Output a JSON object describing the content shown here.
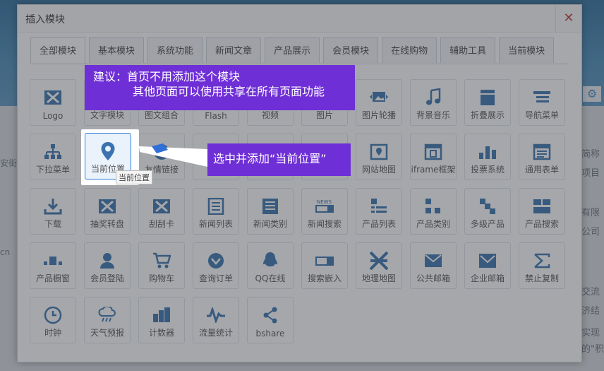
{
  "background": {
    "gear_icon": "⚙",
    "left_fragments": [
      "安街",
      "cn"
    ],
    "right_fragments": [
      "简称",
      "项目",
      "有限",
      "公司",
      "交流",
      "济结",
      "实现",
      "的\"积"
    ]
  },
  "dialog": {
    "title": "插入模块",
    "close_label": "✕",
    "tabs": [
      "全部模块",
      "基本模块",
      "系统功能",
      "新闻文章",
      "产品展示",
      "会员模块",
      "在线购物",
      "辅助工具",
      "当前模块"
    ],
    "active_tab": "全部模块",
    "modules": [
      {
        "label": "Logo",
        "icon": "x-box-icon"
      },
      {
        "label": "文字模块",
        "icon": "text-icon"
      },
      {
        "label": "图文组合",
        "icon": "image-text-icon"
      },
      {
        "label": "Flash",
        "icon": "flash-icon"
      },
      {
        "label": "视频",
        "icon": "video-icon"
      },
      {
        "label": "图片",
        "icon": "image-icon"
      },
      {
        "label": "图片轮播",
        "icon": "carousel-icon"
      },
      {
        "label": "背景音乐",
        "icon": "music-note-icon"
      },
      {
        "label": "折叠展示",
        "icon": "folder-icon"
      },
      {
        "label": "导航菜单",
        "icon": "nav-menu-icon"
      },
      {
        "label": "下拉菜单",
        "icon": "dropdown-menu-icon"
      },
      {
        "label": "当前位置",
        "icon": "location-pin-icon"
      },
      {
        "label": "友情链接",
        "icon": "globe-icon"
      },
      {
        "label": "友",
        "icon": "friend-icon"
      },
      {
        "label": "",
        "icon": "hidden-icon"
      },
      {
        "label": "",
        "icon": "hidden-icon"
      },
      {
        "label": "网站地图",
        "icon": "site-map-icon"
      },
      {
        "label": "iframe框架",
        "icon": "iframe-icon"
      },
      {
        "label": "投票系统",
        "icon": "vote-icon"
      },
      {
        "label": "通用表单",
        "icon": "form-icon"
      },
      {
        "label": "下载",
        "icon": "download-icon"
      },
      {
        "label": "抽奖转盘",
        "icon": "x-box-icon"
      },
      {
        "label": "刮刮卡",
        "icon": "x-box-icon"
      },
      {
        "label": "新闻列表",
        "icon": "news-list-icon"
      },
      {
        "label": "新闻类别",
        "icon": "news-category-icon"
      },
      {
        "label": "新闻搜索",
        "icon": "news-search-icon"
      },
      {
        "label": "产品列表",
        "icon": "product-list-icon"
      },
      {
        "label": "产品类别",
        "icon": "product-category-icon"
      },
      {
        "label": "多级产品",
        "icon": "multi-product-icon"
      },
      {
        "label": "产品搜索",
        "icon": "product-search-icon"
      },
      {
        "label": "产品橱窗",
        "icon": "showcase-icon"
      },
      {
        "label": "会员登陆",
        "icon": "user-icon"
      },
      {
        "label": "购物车",
        "icon": "cart-icon"
      },
      {
        "label": "查询订单",
        "icon": "order-query-icon"
      },
      {
        "label": "QQ在线",
        "icon": "qq-icon"
      },
      {
        "label": "搜索嵌入",
        "icon": "search-embed-icon"
      },
      {
        "label": "地理地图",
        "icon": "geo-map-icon"
      },
      {
        "label": "公共邮箱",
        "icon": "mail-icon"
      },
      {
        "label": "企业邮箱",
        "icon": "enterprise-mail-icon"
      },
      {
        "label": "禁止复制",
        "icon": "no-copy-icon"
      },
      {
        "label": "时钟",
        "icon": "clock-icon"
      },
      {
        "label": "天气预报",
        "icon": "weather-icon"
      },
      {
        "label": "计数器",
        "icon": "counter-icon"
      },
      {
        "label": "流量统计",
        "icon": "traffic-icon"
      },
      {
        "label": "bshare",
        "icon": "share-icon"
      }
    ],
    "tooltip": "当前位置"
  },
  "callouts": {
    "top_line1": "建议：首页不用添加这个模块",
    "top_line2": "其他页面可以使用共享在所有页面功能",
    "right": "选中并添加“当前位置”"
  },
  "colors": {
    "icon_blue": "#3a73ad",
    "callout_purple": "#6f2fd6",
    "close_red": "#c0392b"
  }
}
